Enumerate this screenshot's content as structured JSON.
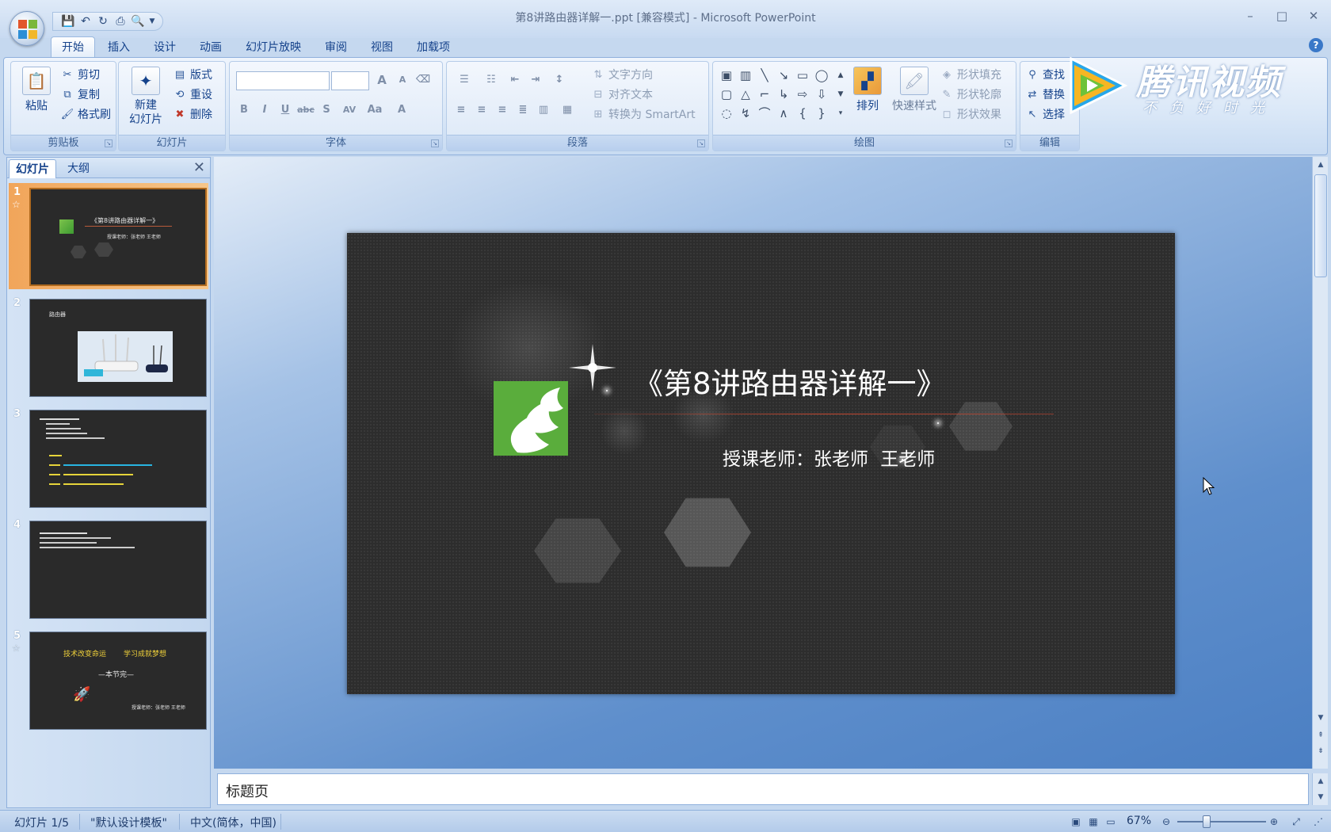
{
  "window": {
    "title": "第8讲路由器详解一.ppt [兼容模式] - Microsoft PowerPoint",
    "controls": [
      "–",
      "□",
      "✕"
    ]
  },
  "qat": {
    "icons": [
      "save-icon",
      "undo-icon",
      "redo-icon",
      "print-icon",
      "print-preview-icon",
      "customize-icon"
    ]
  },
  "tabs": [
    "开始",
    "插入",
    "设计",
    "动画",
    "幻灯片放映",
    "审阅",
    "视图",
    "加载项"
  ],
  "active_tab": "开始",
  "ribbon": {
    "clipboard": {
      "label": "剪贴板",
      "paste": "粘贴",
      "cut": "剪切",
      "copy": "复制",
      "format_painter": "格式刷"
    },
    "slides": {
      "label": "幻灯片",
      "new_slide_1": "新建",
      "new_slide_2": "幻灯片",
      "layout": "版式",
      "reset": "重设",
      "delete": "删除"
    },
    "font": {
      "label": "字体",
      "family": "",
      "size": "",
      "grow": "A",
      "shrink": "A",
      "clear": "",
      "bold": "B",
      "italic": "I",
      "underline": "U",
      "strike": "abc",
      "shadow": "S",
      "spacing": "AV",
      "case": "Aa",
      "color": "A"
    },
    "paragraph": {
      "label": "段落",
      "text_direction": "文字方向",
      "align_text": "对齐文本",
      "smartart": "转换为 SmartArt"
    },
    "drawing": {
      "label": "绘图",
      "arrange": "排列",
      "quick_styles": "快速样式",
      "shape_fill": "形状填充",
      "shape_outline": "形状轮廓",
      "shape_effects": "形状效果"
    },
    "editing": {
      "label": "编辑",
      "find": "查找",
      "replace": "替换",
      "select": "选择"
    }
  },
  "watermark": {
    "name": "腾讯视频",
    "slogan": "不负好时光"
  },
  "left_pane": {
    "tabs": [
      "幻灯片",
      "大纲"
    ],
    "active_tab": "幻灯片",
    "slides": [
      {
        "num": "1",
        "has_animation": true,
        "title": "《第8讲路由器详解一》",
        "subtitle": "授课老师：张老师 王老师"
      },
      {
        "num": "2",
        "has_animation": false,
        "title": "路由器"
      },
      {
        "num": "3",
        "has_animation": false
      },
      {
        "num": "4",
        "has_animation": false
      },
      {
        "num": "5",
        "has_animation": true,
        "line1_a": "技术改变命运",
        "line1_b": "学习成就梦想",
        "line2": "—本节完—",
        "footer": "授课老师：张老师 王老师"
      }
    ]
  },
  "slide": {
    "title": "《第8讲路由器详解一》",
    "subtitle": "授课老师：张老师   王老师"
  },
  "notes": {
    "text": "标题页"
  },
  "status": {
    "slide_pos": "幻灯片 1/5",
    "theme": "\"默认设计模板\"",
    "language": "中文(简体，中国)",
    "zoom": "67%",
    "zoom_level": 0.33
  },
  "colors": {
    "accent": "#15428b",
    "slide_bg": "#2d2d2d",
    "logo_green": "#5aad3c",
    "active_thumb": "#f1a55a"
  }
}
